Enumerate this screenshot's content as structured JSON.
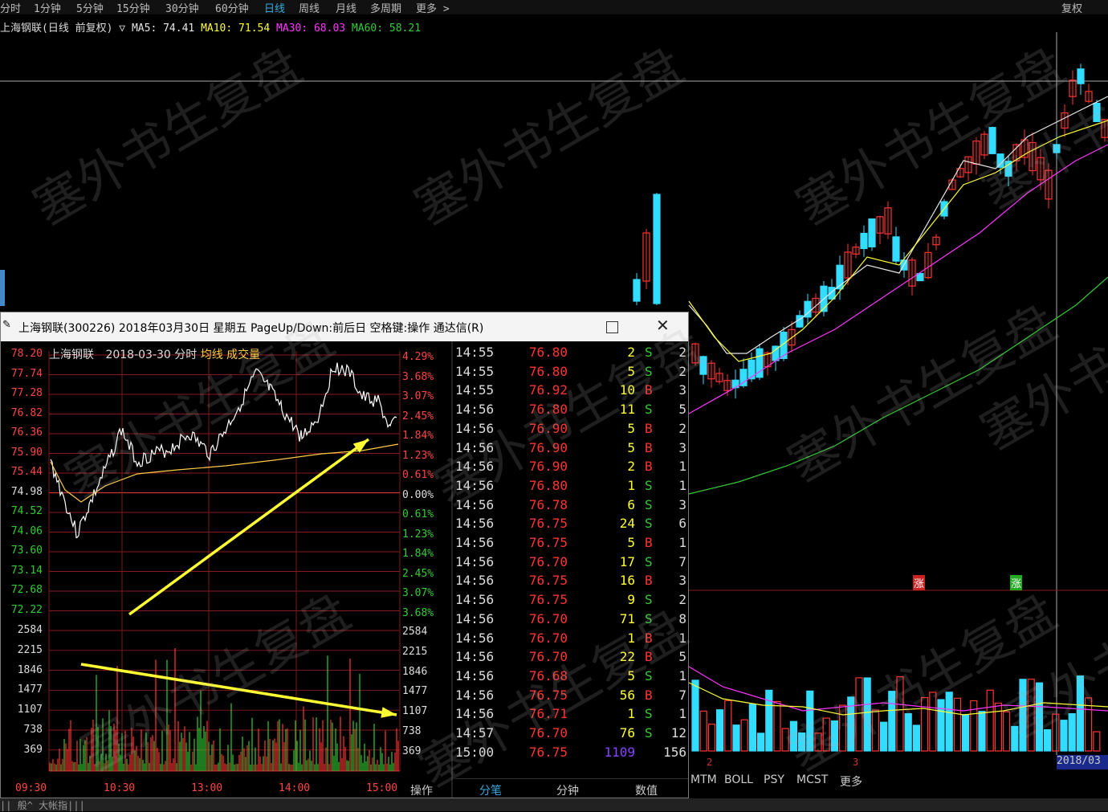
{
  "period_tabs": [
    "分时",
    "1分钟",
    "5分钟",
    "15分钟",
    "30分钟",
    "60分钟",
    "日线",
    "周线",
    "月线",
    "多周期",
    "更多 >"
  ],
  "active_period": "日线",
  "top_right_label": "复权",
  "ma_line": {
    "stock_name": "上海钢联(日线 前复权) ▽",
    "ma5": "MA5: 74.41",
    "ma10": "MA10: 71.54",
    "ma30": "MA30: 68.03",
    "ma60": "MA60: 58.21"
  },
  "colors": {
    "up": "#ff3333",
    "down": "#33ddff",
    "ma5": "#e6e6e6",
    "ma10": "#ffff33",
    "ma30": "#ff33ff",
    "ma60": "#33cc33",
    "price_line": "#ffffff",
    "avg_line": "#ffcc44",
    "arrow": "#ffff33",
    "grid": "#8a1a1a"
  },
  "popup": {
    "title": "上海钢联(300226) 2018年03月30日 星期五 PageUp/Down:前后日 空格键:操作 通达信(R)",
    "header": {
      "name": "上海钢联",
      "date": "2018-03-30 分时",
      "avg": "均线",
      "vol": "成交量"
    },
    "price_labels": [
      "78.20",
      "77.74",
      "77.28",
      "76.82",
      "76.36",
      "75.90",
      "75.44",
      "74.98",
      "74.52",
      "74.06",
      "73.60",
      "73.14",
      "72.68",
      "72.22"
    ],
    "pct_labels": [
      "4.29%",
      "3.68%",
      "3.07%",
      "2.45%",
      "1.84%",
      "1.23%",
      "0.61%",
      "0.00%",
      "0.61%",
      "1.23%",
      "1.84%",
      "2.45%",
      "3.07%",
      "3.68%"
    ],
    "volume_labels": [
      "2584",
      "2215",
      "1846",
      "1477",
      "1107",
      "738",
      "369"
    ],
    "time_labels": [
      "09:30",
      "10:30",
      "13:00",
      "14:00",
      "15:00"
    ],
    "operate_label": "操作",
    "ticks": [
      {
        "time": "14:55",
        "price": "76.80",
        "vol": "2",
        "bs": "S",
        "n": "2"
      },
      {
        "time": "14:55",
        "price": "76.80",
        "vol": "5",
        "bs": "S",
        "n": "2"
      },
      {
        "time": "14:55",
        "price": "76.92",
        "vol": "10",
        "bs": "B",
        "n": "3"
      },
      {
        "time": "14:56",
        "price": "76.80",
        "vol": "11",
        "bs": "S",
        "n": "5"
      },
      {
        "time": "14:56",
        "price": "76.90",
        "vol": "5",
        "bs": "B",
        "n": "2"
      },
      {
        "time": "14:56",
        "price": "76.90",
        "vol": "5",
        "bs": "B",
        "n": "3"
      },
      {
        "time": "14:56",
        "price": "76.90",
        "vol": "2",
        "bs": "B",
        "n": "1"
      },
      {
        "time": "14:56",
        "price": "76.80",
        "vol": "1",
        "bs": "S",
        "n": "1"
      },
      {
        "time": "14:56",
        "price": "76.78",
        "vol": "6",
        "bs": "S",
        "n": "3"
      },
      {
        "time": "14:56",
        "price": "76.75",
        "vol": "24",
        "bs": "S",
        "n": "6"
      },
      {
        "time": "14:56",
        "price": "76.75",
        "vol": "5",
        "bs": "B",
        "n": "1"
      },
      {
        "time": "14:56",
        "price": "76.70",
        "vol": "17",
        "bs": "S",
        "n": "7"
      },
      {
        "time": "14:56",
        "price": "76.75",
        "vol": "16",
        "bs": "B",
        "n": "3"
      },
      {
        "time": "14:56",
        "price": "76.75",
        "vol": "9",
        "bs": "S",
        "n": "2"
      },
      {
        "time": "14:56",
        "price": "76.70",
        "vol": "71",
        "bs": "S",
        "n": "8"
      },
      {
        "time": "14:56",
        "price": "76.70",
        "vol": "1",
        "bs": "B",
        "n": "1"
      },
      {
        "time": "14:56",
        "price": "76.70",
        "vol": "22",
        "bs": "B",
        "n": "5"
      },
      {
        "time": "14:56",
        "price": "76.68",
        "vol": "5",
        "bs": "S",
        "n": "1"
      },
      {
        "time": "14:56",
        "price": "76.75",
        "vol": "56",
        "bs": "B",
        "n": "7"
      },
      {
        "time": "14:56",
        "price": "76.71",
        "vol": "1",
        "bs": "S",
        "n": "1"
      },
      {
        "time": "14:57",
        "price": "76.70",
        "vol": "76",
        "bs": "S",
        "n": "12"
      },
      {
        "time": "15:00",
        "price": "76.75",
        "vol": "1109",
        "bs": "",
        "n": "156"
      }
    ],
    "bottom_tabs": [
      "分笔",
      "分钟",
      "数值"
    ]
  },
  "indicator_tabs": [
    "MTM",
    "BOLL",
    "PSY",
    "MCST",
    "更多"
  ],
  "date_marker": "2018/03",
  "axis_digits": [
    "2",
    "3"
  ],
  "marks": [
    "涨",
    "涨"
  ],
  "status_bar": "|| 般^  大帐指|||",
  "watermark": "塞外书生复盘"
}
